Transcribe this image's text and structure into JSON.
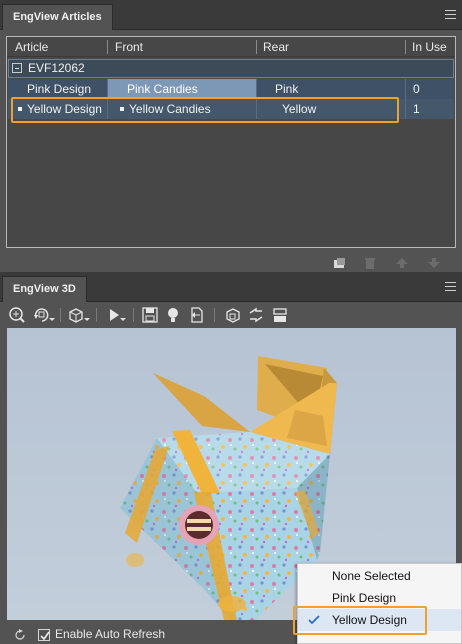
{
  "articles_panel": {
    "title": "EngView Articles",
    "columns": [
      "Article",
      "Front",
      "Rear",
      "In Use"
    ],
    "group": {
      "label": "EVF12062"
    },
    "rows": [
      {
        "article": "Pink Design",
        "front": "Pink Candies",
        "rear": "Pink",
        "in_use": "0"
      },
      {
        "article": "Yellow Design",
        "front": "Yellow Candies",
        "rear": "Yellow",
        "in_use": "1"
      }
    ]
  },
  "viewer_panel": {
    "title": "EngView 3D",
    "auto_refresh": {
      "label": "Enable Auto Refresh",
      "checked": true
    }
  },
  "popup_menu": {
    "items": [
      {
        "label": "None Selected",
        "checked": false
      },
      {
        "label": "Pink Design",
        "checked": false
      },
      {
        "label": "Yellow Design",
        "checked": true
      }
    ]
  },
  "colors": {
    "highlight": "#f0a030",
    "selection": "#7d98b6",
    "panel_bg": "#535353"
  }
}
